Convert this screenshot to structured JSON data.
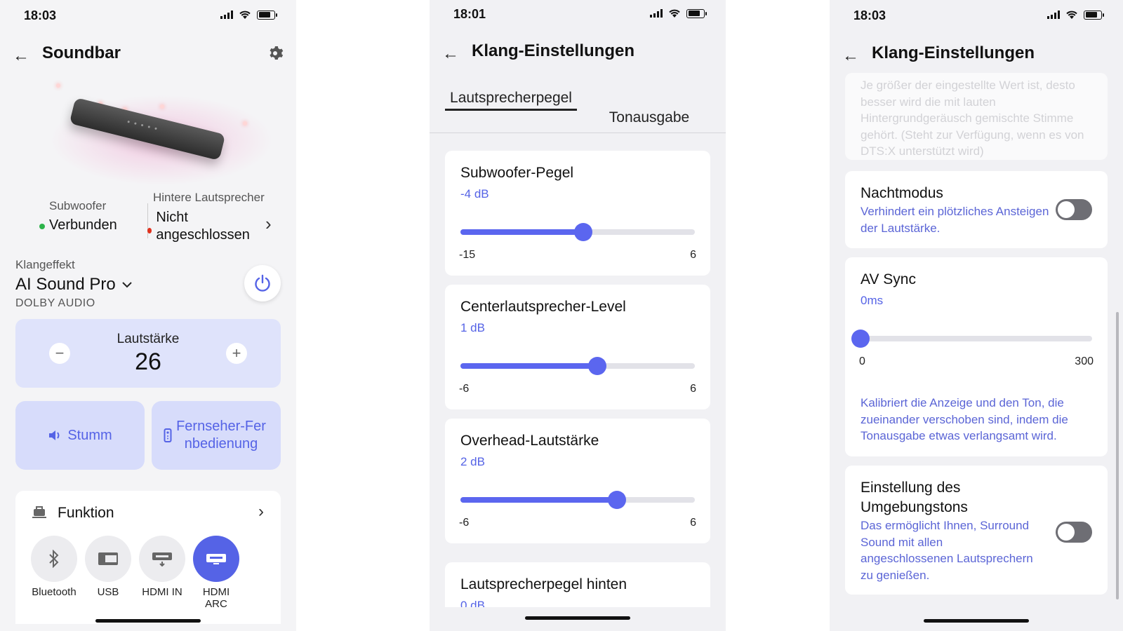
{
  "screen1": {
    "status_time": "18:03",
    "title": "Soundbar",
    "subwoofer_label": "Subwoofer",
    "subwoofer_status": "Verbunden",
    "rear_label": "Hintere Lautsprecher",
    "rear_status": "Nicht angeschlossen",
    "effect_label": "Klangeffekt",
    "effect_value": "AI Sound Pro",
    "effect_sub": "DOLBY AUDIO",
    "volume_label": "Lautstärke",
    "volume_value": "26",
    "mute_label": "Stumm",
    "remote_label": "Fernseher-Fernbedienung",
    "function_title": "Funktion",
    "sources": [
      {
        "name": "Bluetooth",
        "icon": "bluetooth-icon",
        "active": false
      },
      {
        "name": "USB",
        "icon": "usb-icon",
        "active": false
      },
      {
        "name": "HDMI IN",
        "icon": "hdmi-in-icon",
        "active": false
      },
      {
        "name": "HDMI ARC",
        "icon": "hdmi-arc-icon",
        "active": true
      }
    ],
    "colors": {
      "accent": "#5563e6",
      "connected": "#2db34a",
      "disconnected": "#e0321e"
    }
  },
  "screen2": {
    "status_time": "18:01",
    "title": "Klang-Einstellungen",
    "tabs": [
      "Lautsprecherpegel",
      "Tonausgabe"
    ],
    "sliders": [
      {
        "title": "Subwoofer-Pegel",
        "value_label": "-4 dB",
        "min": -15,
        "max": 6,
        "value": -4
      },
      {
        "title": "Centerlautsprecher-Level",
        "value_label": "1 dB",
        "min": -6,
        "max": 6,
        "value": 1
      },
      {
        "title": "Overhead-Lautstärke",
        "value_label": "2 dB",
        "min": -6,
        "max": 6,
        "value": 2
      }
    ],
    "partial_title": "Lautsprecherpegel hinten",
    "partial_value": "0 dB"
  },
  "screen3": {
    "status_time": "18:03",
    "title": "Klang-Einstellungen",
    "faded_text": "Je größer der eingestellte Wert ist, desto besser wird die mit lauten Hintergrundgeräusch gemischte Stimme gehört. (Steht zur Verfügung, wenn es von DTS:X unterstützt wird)",
    "night_title": "Nachtmodus",
    "night_desc": "Verhindert ein plötzliches Ansteigen der Lautstärke.",
    "night_on": false,
    "av_title": "AV Sync",
    "av_value_label": "0ms",
    "av_min": 0,
    "av_max": 300,
    "av_value": 0,
    "av_desc": "Kalibriert die Anzeige und den Ton, die zueinander verschoben sind, indem die Tonausgabe etwas verlangsamt wird.",
    "surround_title": "Einstellung des Umgebungstons",
    "surround_desc": "Das ermöglicht Ihnen, Surround Sound mit allen angeschlossenen Lautsprechern zu genießen.",
    "surround_on": false
  }
}
